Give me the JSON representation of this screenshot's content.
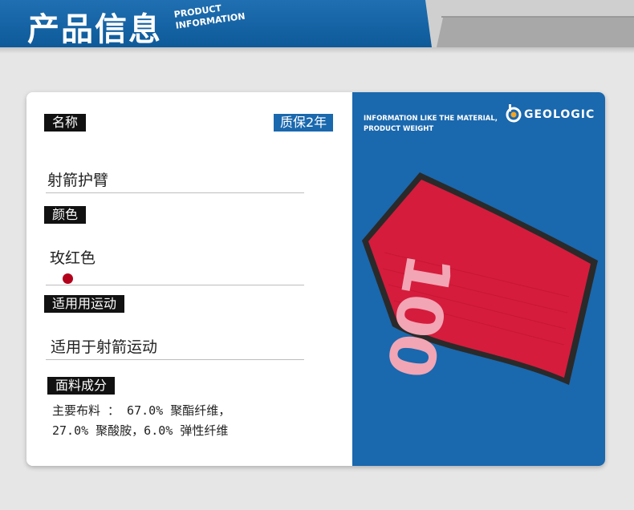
{
  "header": {
    "title": "产品信息",
    "subtitle_line1": "PRODUCT",
    "subtitle_line2": "INFORMATION"
  },
  "specs": {
    "name_label": "名称",
    "warranty": "质保2年",
    "name_value": "射箭护臂",
    "color_label": "颜色",
    "color_value": "玫红色",
    "color_swatch": "#b3001b",
    "usage_label": "适用用运动",
    "usage_value": "适用于射箭运动",
    "material_label": "面料成分",
    "material_line1": "主要布料 ： 67.0% 聚酯纤维，",
    "material_line2": "27.0% 聚酸胺，6.0% 弹性纤维"
  },
  "panel": {
    "info_line1": "INFORMATION LIKE THE MATERIAL,",
    "info_line2": "PRODUCT WEIGHT",
    "brand": "GEOLOGIC",
    "product_print": "100"
  },
  "colors": {
    "header_blue": "#1565a8",
    "panel_blue": "#1a68ae",
    "sleeve_red": "#d51c3c",
    "logo_accent": "#f5a623"
  }
}
